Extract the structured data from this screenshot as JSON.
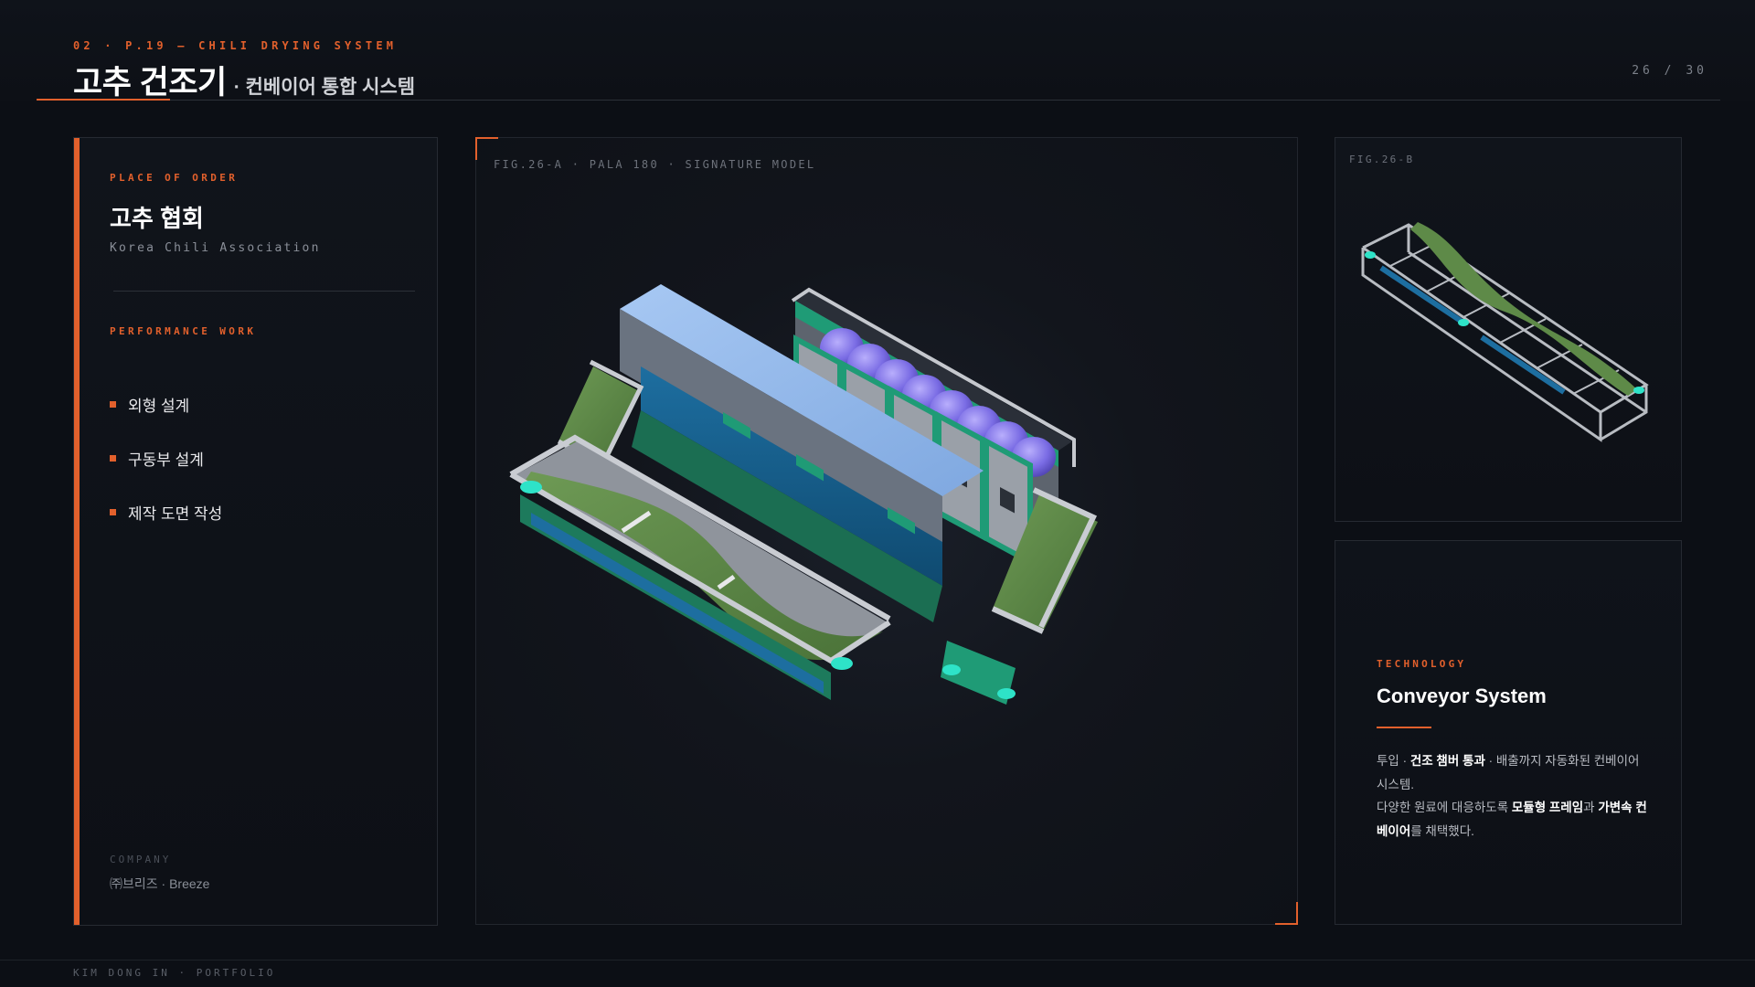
{
  "header": {
    "kicker": "02 · P.19 — CHILI DRYING SYSTEM",
    "title": "고추 건조기",
    "subtitle": "· 컨베이어 통합 시스템",
    "page_counter": "26 / 30"
  },
  "left_panel": {
    "place_label": "PLACE OF ORDER",
    "client_name": "고추 협회",
    "client_name_en": "Korea Chili Association",
    "performance_label": "PERFORMANCE WORK",
    "work_items": [
      "외형 설계",
      "구동부 설계",
      "제작 도면 작성"
    ],
    "company_label": "COMPANY",
    "company_name": "㈜브리즈 · Breeze"
  },
  "center_figure": {
    "caption": "FIG.26-A · PALA 180 · SIGNATURE MODEL"
  },
  "right_top": {
    "caption": "FIG.26-B"
  },
  "right_bottom": {
    "label": "TECHNOLOGY",
    "title": "Conveyor System",
    "desc": {
      "l1_a": "투입 · ",
      "l1_b": "건조 챔버 통과",
      "l1_c": " · 배출까지 자동화된 컨베이어 시스템.",
      "l2_a": "다양한 원료에 대응하도록 ",
      "l2_b": "모듈형 프레임",
      "l2_c": "과 ",
      "l2_d": "가변속 컨베이어",
      "l2_e": "를 채택했다."
    }
  },
  "footer": {
    "text": "KIM DONG IN · PORTFOLIO"
  },
  "colors": {
    "accent": "#e2602c",
    "background": "#0c0f15",
    "steel": "#b8bcc2",
    "belt_green": "#5e8a48",
    "frame_teal": "#1fa57f",
    "hopper_blue": "#8fb8ec",
    "chamber_purple": "#7c6ee6"
  }
}
